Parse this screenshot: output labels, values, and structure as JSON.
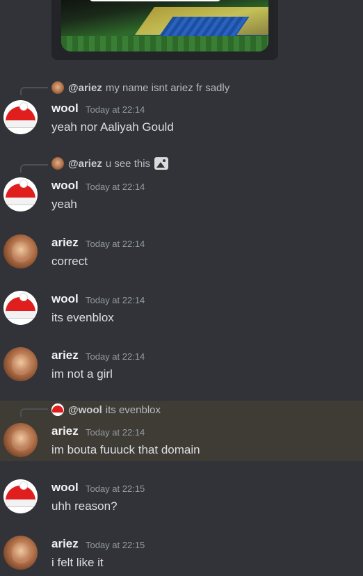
{
  "messages": [
    {
      "author": "wool",
      "time": "Today at 22:14",
      "text": "yeah nor Aaliyah Gould",
      "reply": {
        "author": "@ariez",
        "text": "my name isnt ariez fr sadly",
        "has_image": false
      }
    },
    {
      "author": "wool",
      "time": "Today at 22:14",
      "text": "yeah",
      "reply": {
        "author": "@ariez",
        "text": "u see this",
        "has_image": true
      }
    },
    {
      "author": "ariez",
      "time": "Today at 22:14",
      "text": "correct"
    },
    {
      "author": "wool",
      "time": "Today at 22:14",
      "text": "its evenblox"
    },
    {
      "author": "ariez",
      "time": "Today at 22:14",
      "text": "im not a girl"
    },
    {
      "author": "ariez",
      "time": "Today at 22:14",
      "text": "im bouta fuuuck that domain",
      "highlighted": true,
      "reply": {
        "author": "@wool",
        "text": "its evenblox",
        "has_image": false
      }
    },
    {
      "author": "wool",
      "time": "Today at 22:15",
      "text": "uhh reason?"
    },
    {
      "author": "ariez",
      "time": "Today at 22:15",
      "text": "i felt like it"
    }
  ],
  "colors": {
    "background": "#313338",
    "highlight": "#3f3c36",
    "username": "#f2f3f5",
    "timestamp": "#949ba4",
    "text": "#dbdee1"
  },
  "icons": {
    "reply_image": "image-icon",
    "wool_avatar": "santa-hat-avatar",
    "ariez_avatar": "cat-photo-avatar"
  }
}
